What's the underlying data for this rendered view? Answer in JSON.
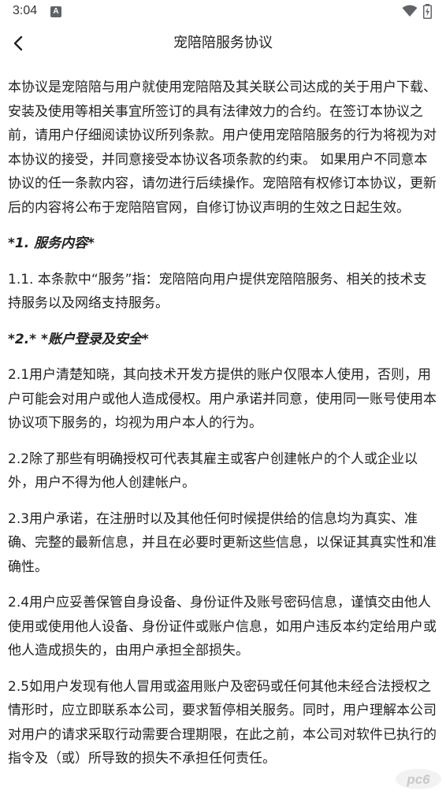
{
  "status_bar": {
    "time": "3:04",
    "notification_icon": "a-icon",
    "wifi_icon": "wifi-icon",
    "battery_icon": "battery-icon"
  },
  "header": {
    "title": "宠陪陪服务协议",
    "back_icon": "chevron-left-icon"
  },
  "content": {
    "paragraphs": [
      "本协议是宠陪陪与用户就使用宠陪陪及其关联公司达成的关于用户下载、安装及使用等相关事宜所签订的具有法律效力的合约。在签订本协议之前，请用户仔细阅读协议所列条款。用户使用宠陪陪服务的行为将视为对本协议的接受，并同意接受本协议各项条款的约束。 如果用户不同意本协议的任一条款内容，请勿进行后续操作。宠陪陪有权修订本协议，更新后的内容将公布于宠陪陪官网，自修订协议声明的生效之日起生效。",
      "*1. 服务内容*",
      "1.1. 本条款中“服务”指：宠陪陪向用户提供宠陪陪服务、相关的技术支持服务以及网络支持服务。",
      "*2.* *账户登录及安全*",
      "2.1用户清楚知晓，其向技术开发方提供的账户仅限本人使用，否则，用户可能会对用户或他人造成侵权。用户承诺并同意，使用同一账号使用本协议项下服务的，均视为用户本人的行为。",
      "2.2除了那些有明确授权可代表其雇主或客户创建帐户的个人或企业以外，用户不得为他人创建帐户。",
      "2.3用户承诺，在注册时以及其他任何时候提供给的信息均为真实、准确、完整的最新信息，并且在必要时更新这些信息，以保证其真实性和准确性。",
      "2.4用户应妥善保管自身设备、身份证件及账号密码信息，谨慎交由他人使用或使用他人设备、身份证件或账户信息，如用户违反本约定给用户或他人造成损失的，由用户承担全部损失。",
      "2.5如用户发现有他人冒用或盗用账户及密码或任何其他未经合法授权之情形时，应立即联系本公司，要求暂停相关服务。同时，用户理解本公司对用户的请求采取行动需要合理期限，在此之前，本公司对软件已执行的指令及（或）所导致的损失不承担任何责任。"
    ]
  },
  "watermark": {
    "text": "pc6",
    "icon": "pc6-logo-icon"
  },
  "colors": {
    "background": "#ffffff",
    "text": "#222222"
  }
}
